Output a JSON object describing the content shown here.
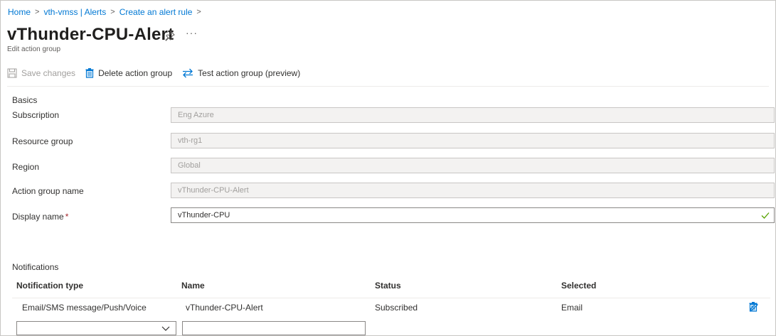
{
  "breadcrumb": {
    "items": [
      "Home",
      "vth-vmss | Alerts",
      "Create an alert rule"
    ]
  },
  "header": {
    "title": "vThunder-CPU-Alert",
    "more_label": "···",
    "subtitle": "Edit action group"
  },
  "toolbar": {
    "save_label": "Save changes",
    "delete_label": "Delete action group",
    "test_label": "Test action group (preview)"
  },
  "basics": {
    "section_label": "Basics",
    "fields": [
      {
        "label": "Subscription",
        "value": "Eng Azure"
      },
      {
        "label": "Resource group",
        "value": "vth-rg1"
      },
      {
        "label": "Region",
        "value": "Global"
      },
      {
        "label": "Action group name",
        "value": "vThunder-CPU-Alert"
      },
      {
        "label": "Display name",
        "value": "vThunder-CPU",
        "required_marker": "*"
      }
    ]
  },
  "notifications": {
    "section_label": "Notifications",
    "columns": [
      "Notification type",
      "Name",
      "Status",
      "Selected"
    ],
    "rows": [
      {
        "type": "Email/SMS message/Push/Voice",
        "name": "vThunder-CPU-Alert",
        "status": "Subscribed",
        "selected": "Email"
      }
    ],
    "new_row": {
      "type_value": "",
      "name_value": ""
    }
  },
  "colors": {
    "accent": "#0078d4",
    "valid_check": "#57a300",
    "required": "#a4262c",
    "disabled_text": "#a19f9d"
  },
  "icons": [
    "pin-icon",
    "save-icon",
    "delete-icon",
    "test-arrows-icon",
    "checkmark-icon",
    "edit-icon",
    "trash-icon",
    "chevron-down-icon"
  ]
}
